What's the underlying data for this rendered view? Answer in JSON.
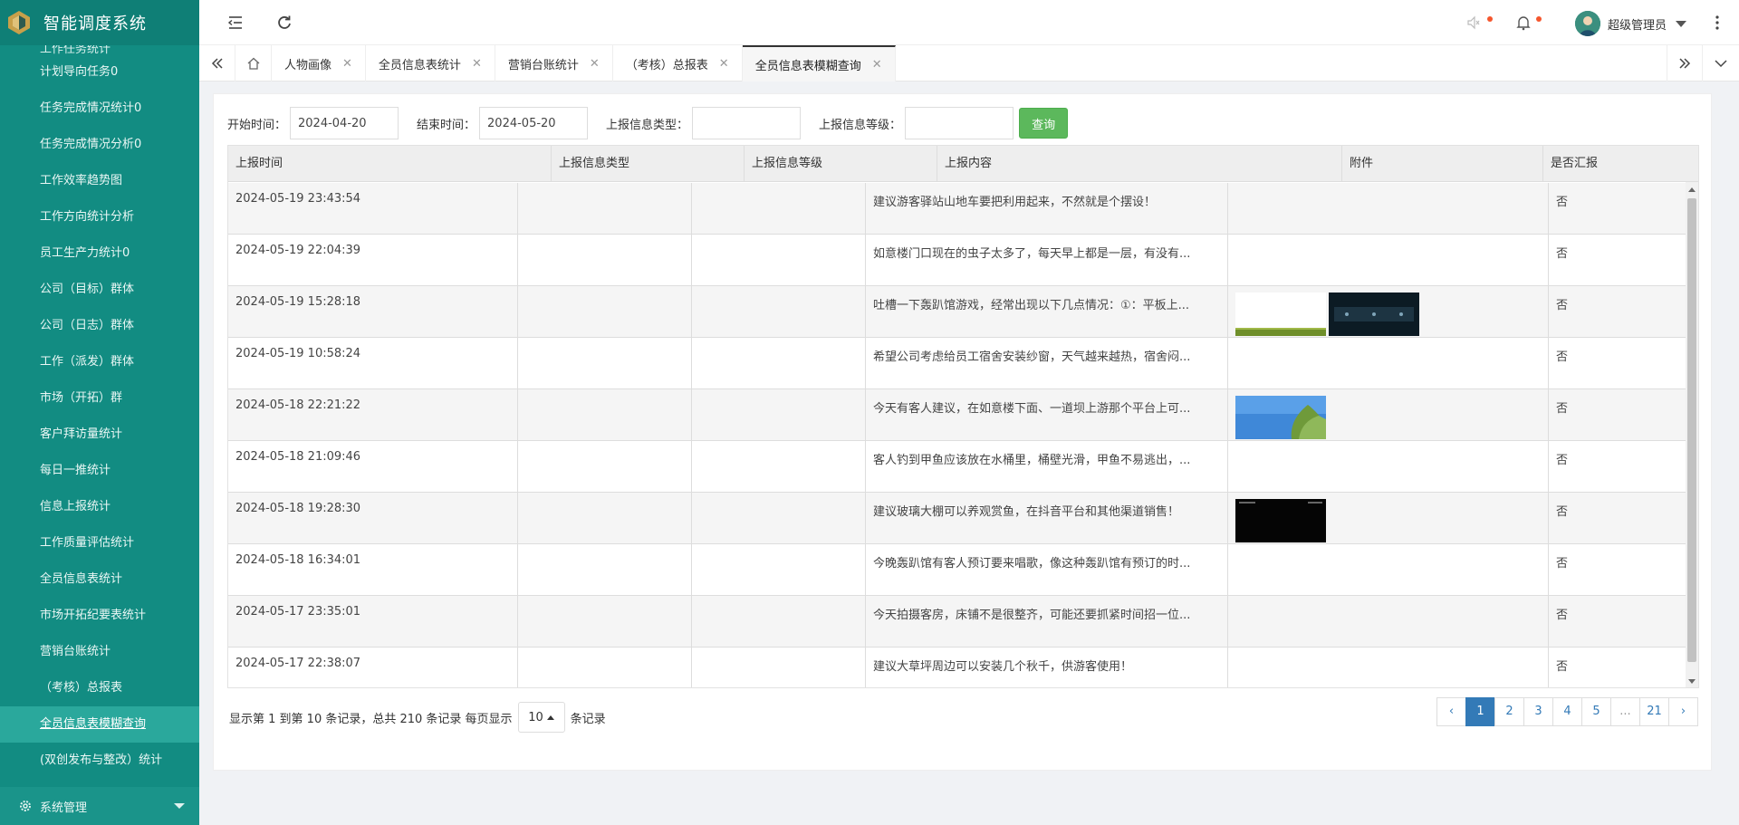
{
  "app": {
    "title": "智能调度系统"
  },
  "sidebar": {
    "items": [
      {
        "label": "计划导向任务0"
      },
      {
        "label": "任务完成情况统计0"
      },
      {
        "label": "任务完成情况分析0"
      },
      {
        "label": "工作效率趋势图"
      },
      {
        "label": "工作方向统计分析"
      },
      {
        "label": "员工生产力统计0"
      },
      {
        "label": "公司（目标）群体"
      },
      {
        "label": "公司（日志）群体"
      },
      {
        "label": "工作（派发）群体"
      },
      {
        "label": "市场（开拓）群"
      },
      {
        "label": "客户拜访量统计"
      },
      {
        "label": "每日一推统计"
      },
      {
        "label": "信息上报统计"
      },
      {
        "label": "工作质量评估统计"
      },
      {
        "label": "全员信息表统计"
      },
      {
        "label": "市场开拓纪要表统计"
      },
      {
        "label": "营销台账统计"
      },
      {
        "label": "（考核）总报表"
      },
      {
        "label": "全员信息表模糊查询"
      },
      {
        "label": "(双创发布与整改）统计"
      }
    ],
    "active_index": 18,
    "system_menu": "系统管理"
  },
  "header": {
    "user_name": "超级管理员",
    "icons": [
      "menu-fold-icon",
      "refresh-icon",
      "speaker-icon",
      "bell-icon",
      "more-icon"
    ]
  },
  "tabs": [
    {
      "label": "人物画像"
    },
    {
      "label": "全员信息表统计"
    },
    {
      "label": "营销台账统计"
    },
    {
      "label": "（考核）总报表"
    },
    {
      "label": "全员信息表模糊查询"
    }
  ],
  "filters": {
    "start_label": "开始时间：",
    "start_value": "2024-04-20",
    "end_label": "结束时间：",
    "end_value": "2024-05-20",
    "type_label": "上报信息类型：",
    "type_value": "",
    "level_label": "上报信息等级：",
    "level_value": "",
    "search_label": "查询"
  },
  "table": {
    "columns": [
      "上报时间",
      "上报信息类型",
      "上报信息等级",
      "上报内容",
      "附件",
      "是否汇报"
    ],
    "rows": [
      {
        "time": "2024-05-19 23:43:54",
        "type": "",
        "level": "",
        "content": "建议游客驿站山地车要把利用起来，不然就是个摆设！",
        "attachments": [],
        "reported": "否"
      },
      {
        "time": "2024-05-19 22:04:39",
        "type": "",
        "level": "",
        "content": "如意楼门口现在的虫子太多了，每天早上都是一层，有没有...",
        "attachments": [],
        "reported": "否"
      },
      {
        "time": "2024-05-19 15:28:18",
        "type": "",
        "level": "",
        "content": "吐槽一下轰趴馆游戏，经常出现以下几点情况：①：平板上...",
        "attachments": [
          "grass",
          "dark-screen"
        ],
        "reported": "否"
      },
      {
        "time": "2024-05-19 10:58:24",
        "type": "",
        "level": "",
        "content": "希望公司考虑给员工宿舍安装纱窗，天气越来越热，宿舍闷...",
        "attachments": [],
        "reported": "否"
      },
      {
        "time": "2024-05-18 22:21:22",
        "type": "",
        "level": "",
        "content": "今天有客人建议，在如意楼下面、一道坝上游那个平台上可...",
        "attachments": [
          "sky-tree"
        ],
        "reported": "否"
      },
      {
        "time": "2024-05-18 21:09:46",
        "type": "",
        "level": "",
        "content": "客人钓到甲鱼应该放在水桶里，桶壁光滑，甲鱼不易逃出，...",
        "attachments": [],
        "reported": "否"
      },
      {
        "time": "2024-05-18 19:28:30",
        "type": "",
        "level": "",
        "content": "建议玻璃大棚可以养观赏鱼，在抖音平台和其他渠道销售！",
        "attachments": [
          "black-screen"
        ],
        "reported": "否"
      },
      {
        "time": "2024-05-18 16:34:01",
        "type": "",
        "level": "",
        "content": "今晚轰趴馆有客人预订要来唱歌，像这种轰趴馆有预订的时...",
        "attachments": [],
        "reported": "否"
      },
      {
        "time": "2024-05-17 23:35:01",
        "type": "",
        "level": "",
        "content": "今天拍摄客房，床铺不是很整齐，可能还要抓紧时间招一位...",
        "attachments": [],
        "reported": "否"
      },
      {
        "time": "2024-05-17 22:38:07",
        "type": "",
        "level": "",
        "content": "建议大草坪周边可以安装几个秋千，供游客使用！",
        "attachments": [],
        "reported": "否"
      }
    ]
  },
  "pagination": {
    "info_prefix": "显示第 1 到第 10 条记录，总共 210 条记录 每页显示",
    "page_size": "10",
    "info_suffix": "条记录",
    "prev": "‹",
    "pages": [
      "1",
      "2",
      "3",
      "4",
      "5",
      "...",
      "21"
    ],
    "next": "›",
    "current": "1"
  },
  "colors": {
    "sidebar_bg": "#128c82",
    "active_item": "#2aa89c",
    "search_button": "#5cb85c",
    "page_active": "#337ab7",
    "notification_dot": "#f5562d"
  }
}
